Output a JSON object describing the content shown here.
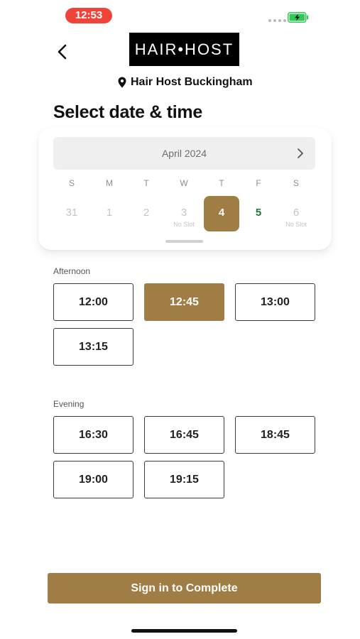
{
  "status_bar": {
    "time": "12:53",
    "battery_icon": "battery-charging-icon",
    "colors": {
      "time_pill": "#f04438",
      "battery": "#34c759"
    }
  },
  "header": {
    "back_icon": "chevron-left-icon",
    "logo_text": "HAIR•HOST",
    "location_icon": "map-pin-icon",
    "location_name": "Hair Host Buckingham"
  },
  "page_title": "Select date & time",
  "calendar": {
    "month": "April 2024",
    "next_icon": "chevron-right-icon",
    "weekdays": [
      "S",
      "M",
      "T",
      "W",
      "T",
      "F",
      "S"
    ],
    "days": [
      {
        "num": "31",
        "note": "",
        "state": "disabled"
      },
      {
        "num": "1",
        "note": "",
        "state": "disabled"
      },
      {
        "num": "2",
        "note": "",
        "state": "disabled"
      },
      {
        "num": "3",
        "note": "No Slot",
        "state": "disabled"
      },
      {
        "num": "4",
        "note": "",
        "state": "selected"
      },
      {
        "num": "5",
        "note": "",
        "state": "available"
      },
      {
        "num": "6",
        "note": "No Slot",
        "state": "disabled"
      }
    ]
  },
  "afternoon": {
    "label": "Afternoon",
    "slots": [
      "12:00",
      "12:45",
      "13:00",
      "13:15"
    ],
    "selected": "12:45"
  },
  "evening": {
    "label": "Evening",
    "slots": [
      "16:30",
      "16:45",
      "18:45",
      "19:00",
      "19:15"
    ]
  },
  "cta_label": "Sign in to Complete",
  "colors": {
    "accent": "#a07d44",
    "available_day": "#1f7a3a"
  }
}
